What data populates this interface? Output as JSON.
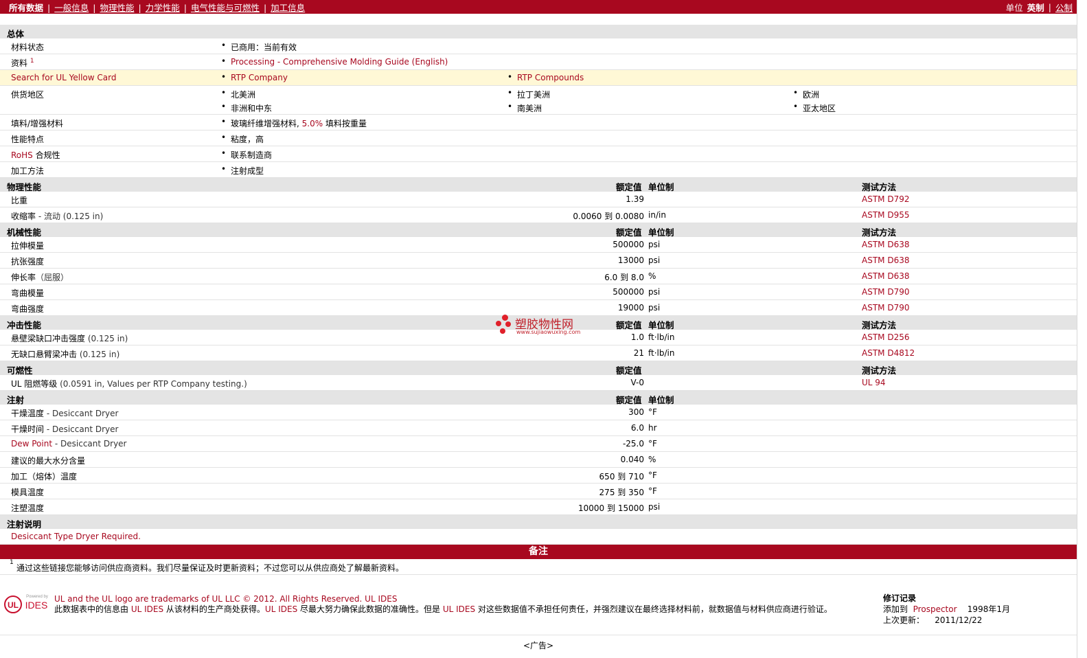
{
  "nav": {
    "items": [
      "所有数据",
      "一般信息",
      "物理性能",
      "力学性能",
      "电气性能与可燃性",
      "加工信息"
    ],
    "units_label": "单位",
    "unit_english": "英制",
    "unit_metric": "公制"
  },
  "general": {
    "header": "总体",
    "material_status_label": "材料状态",
    "material_status_value": "已商用：当前有效",
    "docs_label": "资料",
    "docs_sup": "1",
    "docs_link": "Processing - Comprehensive Molding Guide (English)",
    "ul_label": "Search for UL Yellow Card",
    "ul_link1": "RTP Company",
    "ul_link2": "RTP Compounds",
    "supply_label": "供货地区",
    "regions": [
      "北美洲",
      "拉丁美洲",
      "欧洲",
      "非洲和中东",
      "南美洲",
      "亚太地区"
    ],
    "filler_label": "填料/增强材料",
    "filler_value": "玻璃纤维增强材料,",
    "filler_pct": "5.0%",
    "filler_suffix": "填料按重量",
    "features_label": "性能特点",
    "features_value": "粘度，高",
    "rohs_label": "RoHS",
    "rohs_label2": "合规性",
    "rohs_value": "联系制造商",
    "process_label": "加工方法",
    "process_value": "注射成型"
  },
  "col_headers": {
    "nominal": "额定值",
    "unit": "单位制",
    "method": "测试方法"
  },
  "physical": {
    "header": "物理性能",
    "rows": [
      {
        "name": "比重",
        "cond": "",
        "value": "1.39",
        "unit": "",
        "method": "ASTM D792"
      },
      {
        "name": "收缩率",
        "cond": " - 流动  (0.125 in)",
        "value": "0.0060 到  0.0080",
        "unit": "in/in",
        "method": "ASTM D955"
      }
    ]
  },
  "mechanical": {
    "header": "机械性能",
    "rows": [
      {
        "name": "拉伸模量",
        "cond": "",
        "value": "500000",
        "unit": "psi",
        "method": "ASTM D638"
      },
      {
        "name": "抗张强度",
        "cond": "",
        "value": "13000",
        "unit": "psi",
        "method": "ASTM D638"
      },
      {
        "name": "伸长率",
        "cond": "（屈服）",
        "value": "6.0 到  8.0",
        "unit": "%",
        "method": "ASTM D638"
      },
      {
        "name": "弯曲模量",
        "cond": "",
        "value": "500000",
        "unit": "psi",
        "method": "ASTM D790"
      },
      {
        "name": "弯曲强度",
        "cond": "",
        "value": "19000",
        "unit": "psi",
        "method": "ASTM D790"
      }
    ]
  },
  "impact": {
    "header": "冲击性能",
    "rows": [
      {
        "name": "悬壁梁缺口冲击强度",
        "cond": "  (0.125 in)",
        "value": "1.0",
        "unit": "ft·lb/in",
        "method": "ASTM D256"
      },
      {
        "name": "无缺口悬臂梁冲击",
        "cond": "  (0.125 in)",
        "value": "21",
        "unit": "ft·lb/in",
        "method": "ASTM D4812"
      }
    ]
  },
  "flammability": {
    "header": "可燃性",
    "rows": [
      {
        "name": "UL 阻燃等级",
        "cond": "  (0.0591 in, Values per RTP Company testing.)",
        "value": "V-0",
        "unit": "",
        "method": "UL 94"
      }
    ]
  },
  "injection": {
    "header": "注射",
    "rows": [
      {
        "name": "干燥温度",
        "cond": " - Desiccant Dryer",
        "value": "300",
        "unit": "°F",
        "link": false
      },
      {
        "name": "干燥时间",
        "cond": " - Desiccant Dryer",
        "value": "6.0",
        "unit": "hr",
        "link": false
      },
      {
        "name": "Dew Point",
        "cond": " - Desiccant Dryer",
        "value": "-25.0",
        "unit": "°F",
        "link": true
      },
      {
        "name": "建议的最大水分含量",
        "cond": "",
        "value": "0.040",
        "unit": "%",
        "link": false
      },
      {
        "name": "加工（熔体）温度",
        "cond": "",
        "value": "650 到  710",
        "unit": "°F",
        "link": false
      },
      {
        "name": "模具温度",
        "cond": "",
        "value": "275 到  350",
        "unit": "°F",
        "link": false
      },
      {
        "name": "注塑温度",
        "cond": "",
        "value": "10000 到  15000",
        "unit": "psi",
        "link": false
      }
    ]
  },
  "injection_notes": {
    "header": "注射说明",
    "text": "Desiccant Type Dryer Required."
  },
  "notes": {
    "header": "备注",
    "sup": "1",
    "text": "通过这些链接您能够访问供应商资料。我们尽量保证及时更新资料；不过您可以从供应商处了解最新资料。"
  },
  "footer": {
    "logo_powered": "Powered by",
    "logo_ul": "UL",
    "logo_ides": "IDES",
    "trademark": "UL and the UL logo are trademarks of UL LLC © 2012. All Rights Reserved. UL IDES",
    "disc_1": "此数据表中的信息由 ",
    "disc_r1": "UL IDES",
    "disc_2": " 从该材料的生产商处获得。",
    "disc_r2": "UL IDES",
    "disc_3": " 尽最大努力确保此数据的准确性。但是 ",
    "disc_r3": "UL IDES",
    "disc_4": " 对这些数据值不承担任何责任，并强烈建议在最终选择材料前，就数据值与材料供应商进行验证。",
    "rev_title": "修订记录",
    "rev_added_label": "添加到",
    "rev_added_link": "Prospector",
    "rev_added_date": "1998年1月",
    "rev_updated_label": "上次更新：",
    "rev_updated_date": "2011/12/22"
  },
  "ad": "<广告>",
  "watermark": {
    "title": "塑胶物性网",
    "url": "www.sujiaowuxing.com"
  }
}
